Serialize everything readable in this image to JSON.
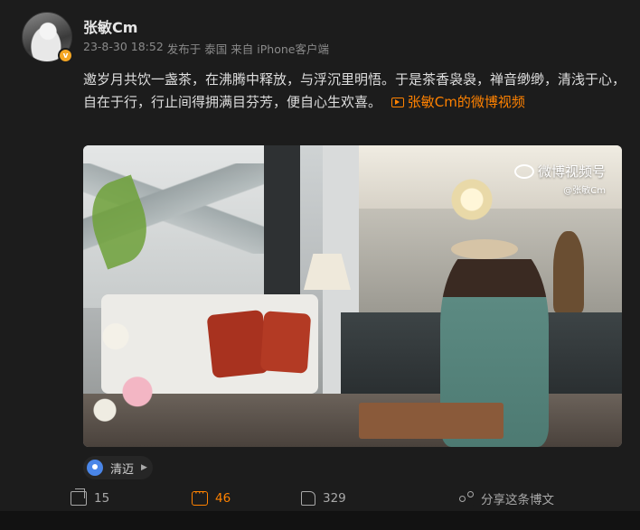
{
  "user": {
    "name": "张敏Cm",
    "verified_badge": "v"
  },
  "meta": {
    "timestamp": "23-8-30 18:52",
    "location_label": "发布于 泰国",
    "source": "来自 iPhone客户端"
  },
  "content": {
    "text": "邀岁月共饮一盏茶，在沸腾中释放，与浮沉里明悟。于是茶香袅袅，禅音缈缈，清浅于心，自在于行，行止间得拥满目芬芳，便自心生欢喜。",
    "video_link": "张敏Cm的微博视频"
  },
  "media": {
    "watermark": "微博视频号",
    "watermark_handle": "@张敏Cm"
  },
  "location_tag": {
    "name": "清迈"
  },
  "actions": {
    "forward_count": "15",
    "comment_count": "46",
    "like_count": "329",
    "share_label": "分享这条博文"
  },
  "colors": {
    "accent": "#ff8200",
    "background": "#1c1c1c",
    "location_pin": "#4a86e8",
    "verified": "#f5a623"
  },
  "icons": {
    "forward": "forward-icon",
    "comment": "comment-icon",
    "like": "like-icon",
    "share": "share-icon",
    "location": "location-pin-icon",
    "video": "video-icon"
  }
}
